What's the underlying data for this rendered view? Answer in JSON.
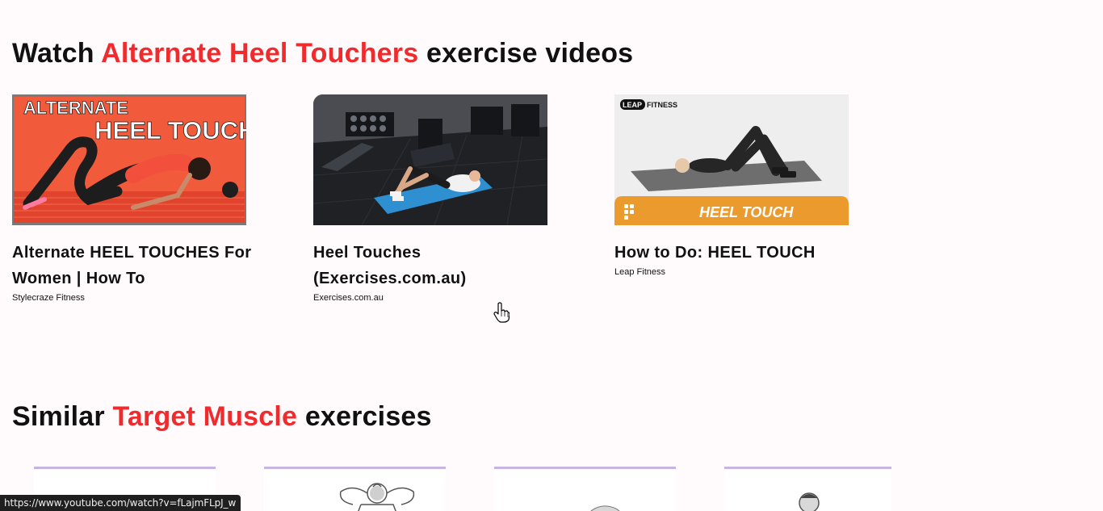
{
  "videos_section": {
    "title_prefix": "Watch",
    "title_accent": "Alternate Heel Touchers",
    "title_suffix": "exercise videos",
    "videos": [
      {
        "title": "Alternate HEEL TOUCHES For Women | How To",
        "channel": "Stylecraze Fitness",
        "thumb_text_line1": "ALTERNATE",
        "thumb_text_line2": "HEEL TOUCHES"
      },
      {
        "title": "Heel Touches (Exercises.com.au)",
        "channel": "Exercises.com.au"
      },
      {
        "title": "How to Do: HEEL TOUCH",
        "channel": "Leap Fitness",
        "thumb_brand": "FITNESS",
        "thumb_brand_badge": "LEAP",
        "thumb_banner": "HEEL TOUCH"
      }
    ]
  },
  "similar_section": {
    "title_prefix": "Similar",
    "title_accent": "Target Muscle",
    "title_suffix": "exercises"
  },
  "status_bar": {
    "url": "https://www.youtube.com/watch?v=fLajmFLpJ_w"
  },
  "colors": {
    "accent": "#ef2b2d",
    "card_border": "#c9b3e0",
    "background": "#fffafb"
  }
}
